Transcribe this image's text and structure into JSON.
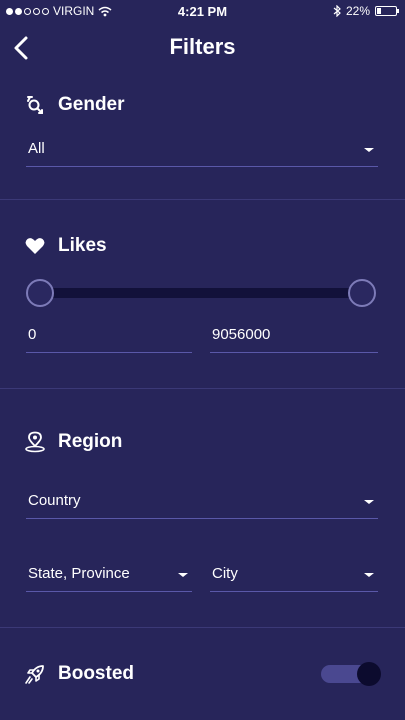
{
  "status_bar": {
    "carrier": "VIRGIN",
    "time": "4:21 PM",
    "battery": "22%",
    "signal_bars_filled": 2,
    "signal_bars_total": 5
  },
  "header": {
    "title": "Filters"
  },
  "gender": {
    "label": "Gender",
    "value": "All",
    "icon": "gender-icon"
  },
  "likes": {
    "label": "Likes",
    "min_value": "0",
    "max_value": "9056000",
    "icon": "heart-icon",
    "range_low_fraction": 0.0,
    "range_high_fraction": 1.0
  },
  "region": {
    "label": "Region",
    "icon": "location-pin-icon",
    "country": "Country",
    "state": "State, Province",
    "city": "City"
  },
  "boosted": {
    "label": "Boosted",
    "icon": "rocket-icon",
    "enabled": true
  },
  "colors": {
    "background": "#27255a",
    "divider": "#3b3977",
    "accent": "#5a58a8",
    "track": "#12113a"
  }
}
